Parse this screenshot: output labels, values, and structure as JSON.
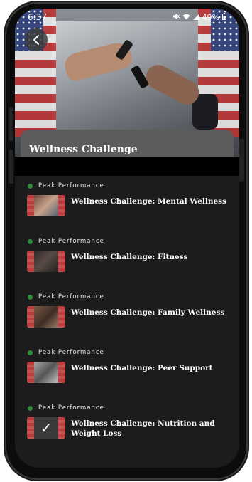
{
  "status_bar": {
    "time": "6:37",
    "battery": "49%",
    "icons": [
      "mute-icon",
      "wifi-icon",
      "signal-icon",
      "battery-icon"
    ]
  },
  "header": {
    "back_icon": "chevron-left-icon",
    "title": "Wellness Challenge"
  },
  "items": [
    {
      "source": "Peak Performance",
      "title": "Wellness Challenge: Mental Wellness"
    },
    {
      "source": "Peak Performance",
      "title": "Wellness Challenge: Fitness"
    },
    {
      "source": "Peak Performance",
      "title": "Wellness Challenge: Family Wellness"
    },
    {
      "source": "Peak Performance",
      "title": "Wellness Challenge: Peer Support"
    },
    {
      "source": "Peak Performance",
      "title": "Wellness Challenge: Nutrition and Weight Loss"
    }
  ],
  "colors": {
    "background": "#1c1c1c",
    "source_dot": "#2e8b3a",
    "title_bar": "#5c5c5c"
  }
}
